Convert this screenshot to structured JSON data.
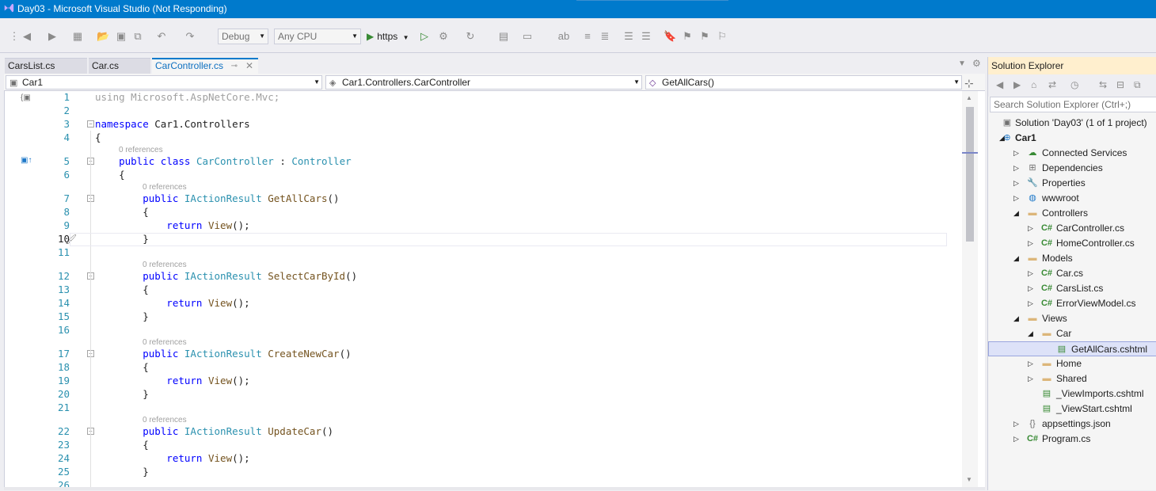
{
  "window": {
    "title": "Day03 - Microsoft Visual Studio (Not Responding)"
  },
  "toolbar": {
    "configuration": "Debug",
    "platform": "Any CPU",
    "run_target": "https"
  },
  "tabs": [
    {
      "label": "CarsList.cs"
    },
    {
      "label": "Car.cs"
    },
    {
      "label": "CarController.cs",
      "active": true
    }
  ],
  "nav": {
    "project": "Car1",
    "type": "Car1.Controllers.CarController",
    "member": "GetAllCars()"
  },
  "code": {
    "line_numbers": [
      "1",
      "2",
      "3",
      "4",
      "5",
      "6",
      "7",
      "8",
      "9",
      "10",
      "11",
      "12",
      "13",
      "14",
      "15",
      "16",
      "17",
      "18",
      "19",
      "20",
      "21",
      "22",
      "23",
      "24",
      "25",
      "26"
    ],
    "lines": [
      {
        "parts": [
          {
            "t": "using Microsoft.AspNetCore.Mvc;",
            "c": "dim"
          }
        ]
      },
      {
        "parts": []
      },
      {
        "parts": [
          {
            "t": "namespace ",
            "c": "kw"
          },
          {
            "t": "Car1.Controllers",
            "c": ""
          }
        ]
      },
      {
        "parts": [
          {
            "t": "{",
            "c": ""
          }
        ]
      },
      {
        "parts": [
          {
            "t": "    public ",
            "c": "kw"
          },
          {
            "t": "class ",
            "c": "kw"
          },
          {
            "t": "CarController",
            "c": "ty"
          },
          {
            "t": " : ",
            "c": ""
          },
          {
            "t": "Controller",
            "c": "ty"
          }
        ]
      },
      {
        "parts": [
          {
            "t": "    {",
            "c": ""
          }
        ]
      },
      {
        "parts": [
          {
            "t": "        public ",
            "c": "kw"
          },
          {
            "t": "IActionResult ",
            "c": "ty"
          },
          {
            "t": "GetAllCars",
            "c": "fn"
          },
          {
            "t": "()",
            "c": ""
          }
        ]
      },
      {
        "parts": [
          {
            "t": "        {",
            "c": ""
          }
        ]
      },
      {
        "parts": [
          {
            "t": "            return ",
            "c": "kw"
          },
          {
            "t": "View",
            "c": "fn"
          },
          {
            "t": "();",
            "c": ""
          }
        ]
      },
      {
        "parts": [
          {
            "t": "        }",
            "c": ""
          }
        ]
      },
      {
        "parts": []
      },
      {
        "parts": [
          {
            "t": "        public ",
            "c": "kw"
          },
          {
            "t": "IActionResult ",
            "c": "ty"
          },
          {
            "t": "SelectCarById",
            "c": "fn"
          },
          {
            "t": "()",
            "c": ""
          }
        ]
      },
      {
        "parts": [
          {
            "t": "        {",
            "c": ""
          }
        ]
      },
      {
        "parts": [
          {
            "t": "            return ",
            "c": "kw"
          },
          {
            "t": "View",
            "c": "fn"
          },
          {
            "t": "();",
            "c": ""
          }
        ]
      },
      {
        "parts": [
          {
            "t": "        }",
            "c": ""
          }
        ]
      },
      {
        "parts": []
      },
      {
        "parts": [
          {
            "t": "        public ",
            "c": "kw"
          },
          {
            "t": "IActionResult ",
            "c": "ty"
          },
          {
            "t": "CreateNewCar",
            "c": "fn"
          },
          {
            "t": "()",
            "c": ""
          }
        ]
      },
      {
        "parts": [
          {
            "t": "        {",
            "c": ""
          }
        ]
      },
      {
        "parts": [
          {
            "t": "            return ",
            "c": "kw"
          },
          {
            "t": "View",
            "c": "fn"
          },
          {
            "t": "();",
            "c": ""
          }
        ]
      },
      {
        "parts": [
          {
            "t": "        }",
            "c": ""
          }
        ]
      },
      {
        "parts": []
      },
      {
        "parts": [
          {
            "t": "        public ",
            "c": "kw"
          },
          {
            "t": "IActionResult ",
            "c": "ty"
          },
          {
            "t": "UpdateCar",
            "c": "fn"
          },
          {
            "t": "()",
            "c": ""
          }
        ]
      },
      {
        "parts": [
          {
            "t": "        {",
            "c": ""
          }
        ]
      },
      {
        "parts": [
          {
            "t": "            return ",
            "c": "kw"
          },
          {
            "t": "View",
            "c": "fn"
          },
          {
            "t": "();",
            "c": ""
          }
        ]
      },
      {
        "parts": [
          {
            "t": "        }",
            "c": ""
          }
        ]
      },
      {
        "parts": []
      }
    ],
    "references_label": "0 references",
    "current_line": "10"
  },
  "solution_explorer": {
    "title": "Solution Explorer",
    "search_placeholder": "Search Solution Explorer (Ctrl+;)",
    "tree": [
      {
        "label": "Solution 'Day03' (1 of 1 project)",
        "icon": "solution-icon",
        "level": 0,
        "expander": ""
      },
      {
        "label": "Car1",
        "icon": "web-project-icon",
        "level": 0,
        "expander": "◢",
        "bold": true
      },
      {
        "label": "Connected Services",
        "icon": "cloud-icon",
        "level": 1,
        "expander": "▷"
      },
      {
        "label": "Dependencies",
        "icon": "dependencies-icon",
        "level": 1,
        "expander": "▷"
      },
      {
        "label": "Properties",
        "icon": "wrench-icon",
        "level": 1,
        "expander": "▷"
      },
      {
        "label": "wwwroot",
        "icon": "globe-icon",
        "level": 1,
        "expander": "▷"
      },
      {
        "label": "Controllers",
        "icon": "folder-icon",
        "level": 1,
        "expander": "◢"
      },
      {
        "label": "CarController.cs",
        "icon": "csharp-file-icon",
        "level": 2,
        "expander": "▷"
      },
      {
        "label": "HomeController.cs",
        "icon": "csharp-file-icon",
        "level": 2,
        "expander": "▷"
      },
      {
        "label": "Models",
        "icon": "folder-icon",
        "level": 1,
        "expander": "◢"
      },
      {
        "label": "Car.cs",
        "icon": "csharp-file-icon",
        "level": 2,
        "expander": "▷"
      },
      {
        "label": "CarsList.cs",
        "icon": "csharp-file-icon",
        "level": 2,
        "expander": "▷"
      },
      {
        "label": "ErrorViewModel.cs",
        "icon": "csharp-file-icon",
        "level": 2,
        "expander": "▷"
      },
      {
        "label": "Views",
        "icon": "folder-icon",
        "level": 1,
        "expander": "◢"
      },
      {
        "label": "Car",
        "icon": "folder-icon",
        "level": 2,
        "expander": "◢"
      },
      {
        "label": "GetAllCars.cshtml",
        "icon": "razor-file-icon",
        "level": 3,
        "expander": "",
        "selected": true
      },
      {
        "label": "Home",
        "icon": "folder-icon",
        "level": 2,
        "expander": "▷"
      },
      {
        "label": "Shared",
        "icon": "folder-icon",
        "level": 2,
        "expander": "▷"
      },
      {
        "label": "_ViewImports.cshtml",
        "icon": "razor-file-icon",
        "level": 2,
        "expander": ""
      },
      {
        "label": "_ViewStart.cshtml",
        "icon": "razor-file-icon",
        "level": 2,
        "expander": ""
      },
      {
        "label": "appsettings.json",
        "icon": "json-file-icon",
        "level": 1,
        "expander": "▷"
      },
      {
        "label": "Program.cs",
        "icon": "csharp-file-icon",
        "level": 1,
        "expander": "▷"
      }
    ]
  },
  "colors": {
    "title_bar": "#007acc",
    "accent": "#007acc",
    "solution_explorer_header": "#ffefce",
    "keyword": "#0000ff",
    "type": "#2b91af",
    "method": "#74531f"
  }
}
